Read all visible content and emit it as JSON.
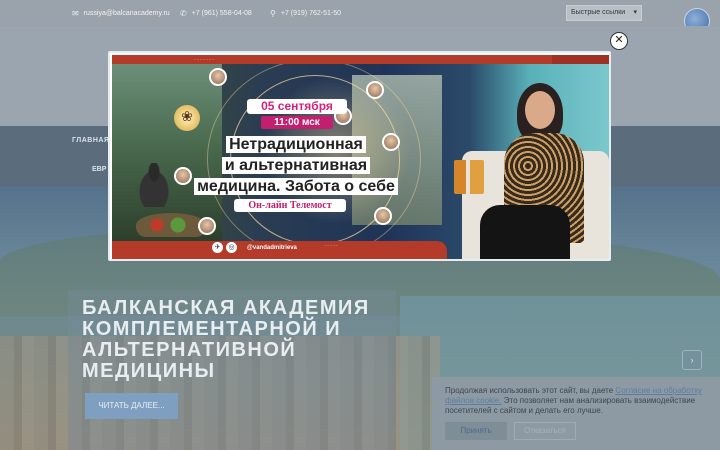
{
  "topbar": {
    "email": "russiya@balcanacademy.ru",
    "phone1": "+7 (961) 558-04-08",
    "phone2": "+7 (919) 762-51-50",
    "quick_links": "Быстрые ссылки"
  },
  "nav": {
    "item1": "ГЛАВНАЯ",
    "item2": "ЕВР"
  },
  "hero": {
    "title": "БАЛКАНСКАЯ АКАДЕМИЯ КОМПЛЕМЕНТАРНОЙ И АЛЬТЕРНАТИВНОЙ МЕДИЦИНЫ",
    "read_more": "ЧИТАТЬ ДАЛЕЕ..."
  },
  "banner": {
    "date": "05 сентября",
    "time": "11:00 мск",
    "title_line1": "Нетрадиционная",
    "title_line2": "и альтернативная",
    "title_line3": "медицина. Забота о себе",
    "subtitle": "Он-лайн Телемост",
    "handle": "@vandadmitrieva"
  },
  "cookie": {
    "text_before": "Продолжая использовать этот сайт, вы даете ",
    "link": "Согласие на обработку файлов cookie.",
    "text_after": " Это позволяет нам анализировать взаимодействие посетителей с сайтом и делать его лучше.",
    "accept": "Принять",
    "decline": "Отказаться"
  },
  "icons": {
    "close": "close-icon",
    "email": "envelope-icon",
    "phone": "phone-icon",
    "pin": "map-pin-icon"
  }
}
